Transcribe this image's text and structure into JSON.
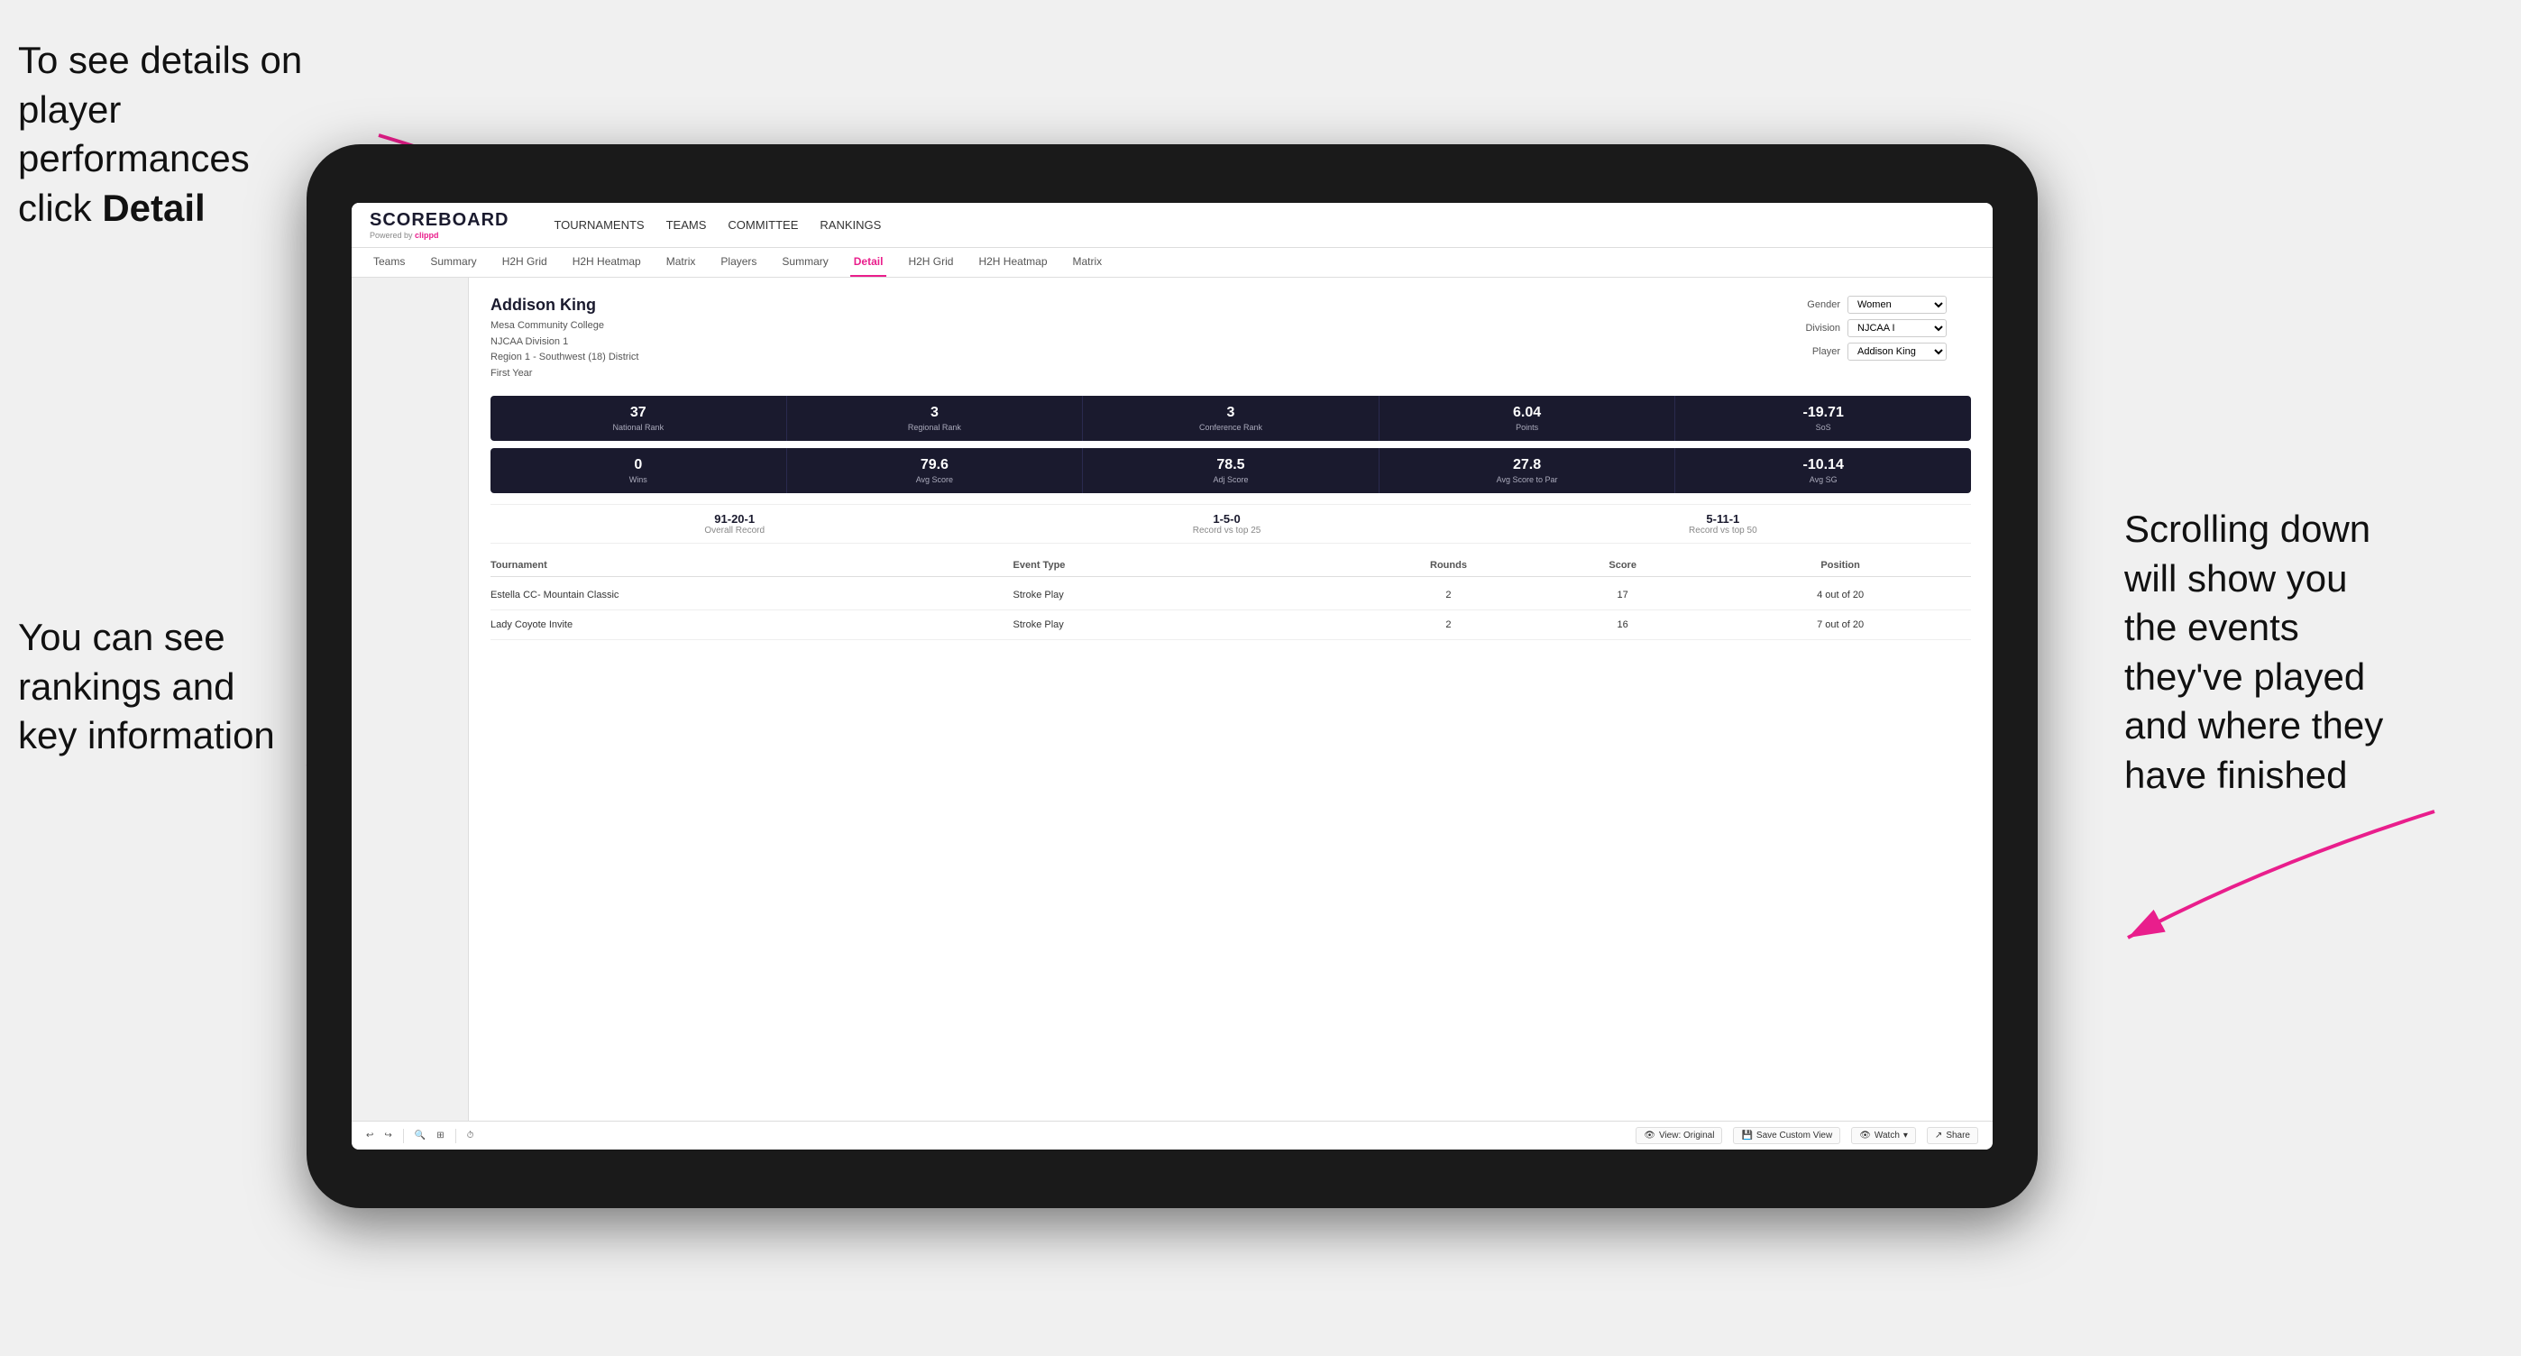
{
  "annotations": {
    "topleft": {
      "line1": "To see details on",
      "line2": "player performances",
      "line3": "click ",
      "bold": "Detail"
    },
    "bottomleft": {
      "line1": "You can see",
      "line2": "rankings and",
      "line3": "key information"
    },
    "bottomright": {
      "line1": "Scrolling down",
      "line2": "will show you",
      "line3": "the events",
      "line4": "they've played",
      "line5": "and where they",
      "line6": "have finished"
    }
  },
  "nav": {
    "logo": "SCOREBOARD",
    "powered_by": "Powered by ",
    "clippd": "clippd",
    "links": [
      "TOURNAMENTS",
      "TEAMS",
      "COMMITTEE",
      "RANKINGS"
    ]
  },
  "sub_nav": {
    "items": [
      "Teams",
      "Summary",
      "H2H Grid",
      "H2H Heatmap",
      "Matrix",
      "Players",
      "Summary",
      "Detail",
      "H2H Grid",
      "H2H Heatmap",
      "Matrix"
    ],
    "active": "Detail"
  },
  "player": {
    "name": "Addison King",
    "college": "Mesa Community College",
    "division": "NJCAA Division 1",
    "region": "Region 1 - Southwest (18) District",
    "year": "First Year",
    "filters": {
      "gender_label": "Gender",
      "gender_value": "Women",
      "division_label": "Division",
      "division_value": "NJCAA I",
      "player_label": "Player",
      "player_value": "Addison King"
    }
  },
  "stats_row1": [
    {
      "value": "37",
      "label": "National Rank"
    },
    {
      "value": "3",
      "label": "Regional Rank"
    },
    {
      "value": "3",
      "label": "Conference Rank"
    },
    {
      "value": "6.04",
      "label": "Points"
    },
    {
      "value": "-19.71",
      "label": "SoS"
    }
  ],
  "stats_row2": [
    {
      "value": "0",
      "label": "Wins"
    },
    {
      "value": "79.6",
      "label": "Avg Score"
    },
    {
      "value": "78.5",
      "label": "Adj Score"
    },
    {
      "value": "27.8",
      "label": "Avg Score to Par"
    },
    {
      "value": "-10.14",
      "label": "Avg SG"
    }
  ],
  "records": [
    {
      "value": "91-20-1",
      "label": "Overall Record"
    },
    {
      "value": "1-5-0",
      "label": "Record vs top 25"
    },
    {
      "value": "5-11-1",
      "label": "Record vs top 50"
    }
  ],
  "table": {
    "headers": [
      "Tournament",
      "Event Type",
      "Rounds",
      "Score",
      "Position"
    ],
    "rows": [
      {
        "tournament": "Estella CC- Mountain Classic",
        "event_type": "Stroke Play",
        "rounds": "2",
        "score": "17",
        "position": "4 out of 20"
      },
      {
        "tournament": "Lady Coyote Invite",
        "event_type": "Stroke Play",
        "rounds": "2",
        "score": "16",
        "position": "7 out of 20"
      }
    ]
  },
  "toolbar": {
    "view_original": "View: Original",
    "save_custom": "Save Custom View",
    "watch": "Watch",
    "share": "Share"
  }
}
